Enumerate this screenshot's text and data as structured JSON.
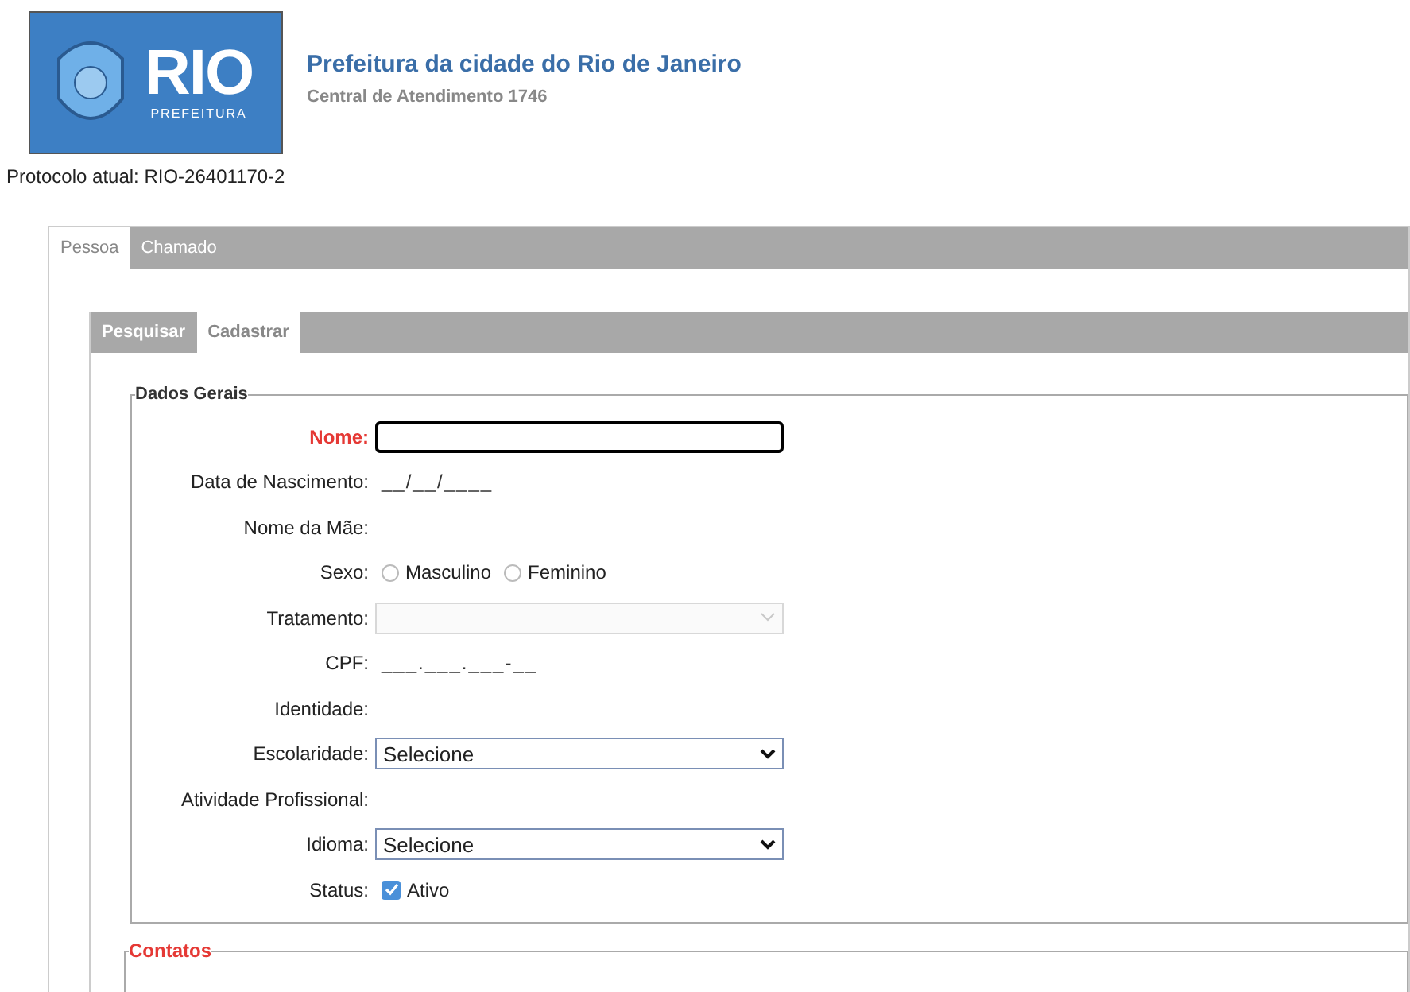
{
  "header": {
    "logo_text": "RIO",
    "logo_subtext": "PREFEITURA",
    "title": "Prefeitura da cidade do Rio de Janeiro",
    "subtitle": "Central de Atendimento 1746"
  },
  "protocol": "Protocolo atual: RIO-26401170-2",
  "tabs": [
    {
      "label": "Pessoa",
      "selected": true
    },
    {
      "label": "Chamado",
      "selected": false
    }
  ],
  "subtabs": [
    {
      "label": "Pesquisar",
      "selected": false
    },
    {
      "label": "Cadastrar",
      "selected": true
    }
  ],
  "fieldset": {
    "legend": "Dados Gerais",
    "fields": [
      {
        "kind": "text",
        "label": "Nome:",
        "required": true
      },
      {
        "kind": "mask",
        "label": "Data de Nascimento:",
        "value": "__/__/____"
      },
      {
        "kind": "label",
        "label": "Nome da Mãe:"
      },
      {
        "kind": "radio",
        "label": "Sexo:",
        "options": [
          {
            "label": "Masculino",
            "selected": false
          },
          {
            "label": "Feminino",
            "selected": false
          }
        ]
      },
      {
        "kind": "select",
        "label": "Tratamento:",
        "disabled": true
      },
      {
        "kind": "mask",
        "label": "CPF:",
        "value": "___.___.___-__"
      },
      {
        "kind": "label",
        "label": "Identidade:"
      },
      {
        "kind": "select",
        "label": "Escolaridade:",
        "value": "Selecione",
        "disabled": false
      },
      {
        "kind": "label",
        "label": "Atividade Profissional:"
      },
      {
        "kind": "select",
        "label": "Idioma:",
        "value": "Selecione",
        "disabled": false
      },
      {
        "kind": "checkbox",
        "label": "Status:",
        "option": "Ativo",
        "checked": true
      }
    ]
  },
  "next_legend": "Contatos"
}
